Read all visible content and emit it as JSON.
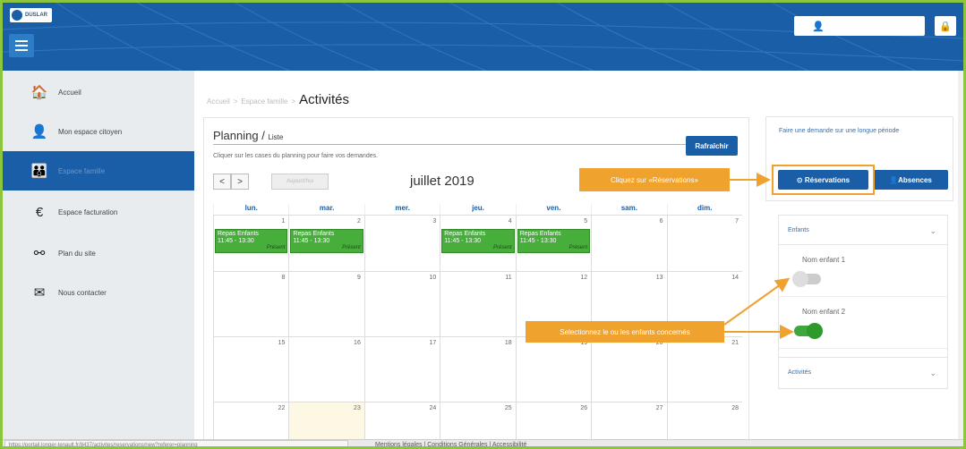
{
  "header": {
    "logo_text": "DUSLAR",
    "menu_icon": "hamburger-icon",
    "user_icon": "user-icon",
    "lock_icon": "lock-icon"
  },
  "sidebar": {
    "items": [
      {
        "label": "Accueil",
        "icon": "home-icon",
        "glyph": "🏠"
      },
      {
        "label": "Mon espace citoyen",
        "icon": "user-icon",
        "glyph": "👤"
      },
      {
        "label": "Espace famille",
        "icon": "family-icon",
        "glyph": "👪"
      },
      {
        "label": "Espace facturation",
        "icon": "euro-icon",
        "glyph": "€"
      },
      {
        "label": "Plan du site",
        "icon": "sitemap-icon",
        "glyph": "⚯"
      },
      {
        "label": "Nous contacter",
        "icon": "envelope-icon",
        "glyph": "✉"
      }
    ]
  },
  "breadcrumb": {
    "home": "Accueil",
    "sep1": ">",
    "section": "Espace famille",
    "sep2": ">",
    "current": "Activités"
  },
  "planning": {
    "title": "Planning",
    "sep": " / ",
    "list_link": "Liste",
    "refresh_label": "Rafraîchir",
    "hint": "Cliquer sur les cases du planning pour faire vos demandes.",
    "prev": "<",
    "next": ">",
    "today_label": "Aujourd'hui",
    "month_label": "juillet 2019"
  },
  "calendar": {
    "days": [
      "lun.",
      "mar.",
      "mer.",
      "jeu.",
      "ven.",
      "sam.",
      "dim."
    ],
    "weeks": [
      [
        "1",
        "2",
        "3",
        "4",
        "5",
        "6",
        "7"
      ],
      [
        "8",
        "9",
        "10",
        "11",
        "12",
        "13",
        "14"
      ],
      [
        "15",
        "16",
        "17",
        "18",
        "19",
        "20",
        "21"
      ],
      [
        "22",
        "23",
        "24",
        "25",
        "26",
        "27",
        "28"
      ]
    ],
    "event": {
      "title": "Repas Enfants",
      "time": "11:45 - 13:30",
      "status": "Présent"
    }
  },
  "right": {
    "long_period_text": "Faire une demande sur une longue période",
    "reservations_label": "Réservations",
    "absences_label": "Absences",
    "children_header": "Enfants",
    "children": [
      {
        "name": "Nom enfant 1",
        "enabled": false
      },
      {
        "name": "Nom enfant 2",
        "enabled": true
      }
    ],
    "activities_header": "Activités"
  },
  "callouts": {
    "reservations": "Cliquez sur «Réservations»",
    "children": "Selectionnez le ou les enfants concernés"
  },
  "footer": {
    "url": "https://portail.longer-tenault.fr/8437/activites/reservations/new?referer=planning",
    "links": "Mentions légales  |  Conditions Générales  |  Accessibilité"
  },
  "colors": {
    "brand": "#1a5ea8",
    "accent": "#f0a22e",
    "event": "#47ae3c",
    "frame": "#8cc63f"
  }
}
